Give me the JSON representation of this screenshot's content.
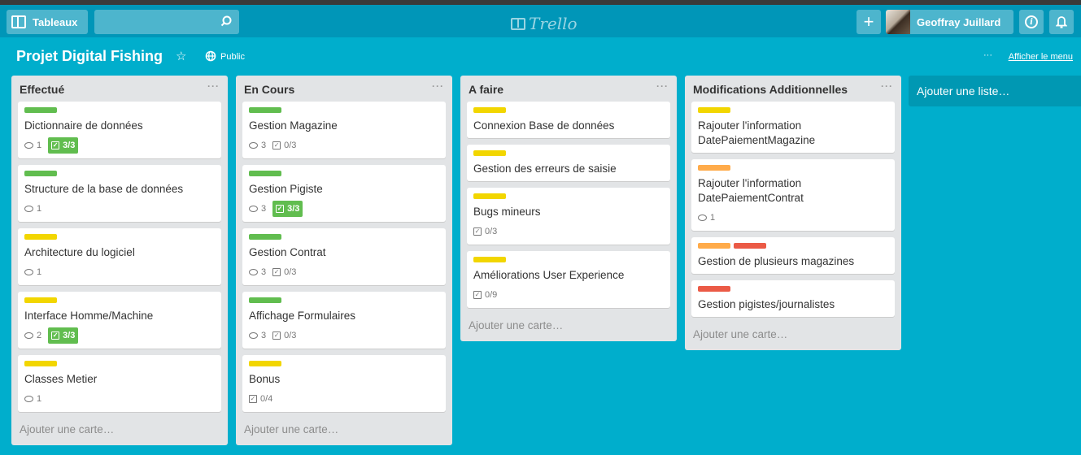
{
  "header": {
    "boards_label": "Tableaux",
    "logo_text": "Trello",
    "user_name": "Geoffray Juillard"
  },
  "board": {
    "title": "Projet Digital Fishing",
    "visibility": "Public",
    "menu_dots": "···",
    "show_menu_label": "Afficher le menu"
  },
  "colors": {
    "background": "#00aecc",
    "header": "#0096b8",
    "label_green": "#61bd4f",
    "label_yellow": "#f2d600",
    "label_orange": "#ffab4a",
    "label_red": "#eb5a46"
  },
  "lists": [
    {
      "name": "Effectué",
      "add_card": "Ajouter une carte…",
      "cards": [
        {
          "title": "Dictionnaire de données",
          "labels": [
            "green"
          ],
          "comments": "1",
          "checklist": "3/3",
          "complete": true
        },
        {
          "title": "Structure de la base de données",
          "labels": [
            "green"
          ],
          "comments": "1"
        },
        {
          "title": "Architecture du logiciel",
          "labels": [
            "yellow"
          ],
          "comments": "1"
        },
        {
          "title": "Interface Homme/Machine",
          "labels": [
            "yellow"
          ],
          "comments": "2",
          "checklist": "3/3",
          "complete": true
        },
        {
          "title": "Classes Metier",
          "labels": [
            "yellow"
          ],
          "comments": "1"
        }
      ]
    },
    {
      "name": "En Cours",
      "add_card": "Ajouter une carte…",
      "cards": [
        {
          "title": "Gestion Magazine",
          "labels": [
            "green"
          ],
          "comments": "3",
          "checklist": "0/3"
        },
        {
          "title": "Gestion Pigiste",
          "labels": [
            "green"
          ],
          "comments": "3",
          "checklist": "3/3",
          "complete": true
        },
        {
          "title": "Gestion Contrat",
          "labels": [
            "green"
          ],
          "comments": "3",
          "checklist": "0/3"
        },
        {
          "title": "Affichage Formulaires",
          "labels": [
            "green"
          ],
          "comments": "3",
          "checklist": "0/3"
        },
        {
          "title": "Bonus",
          "labels": [
            "yellow"
          ],
          "checklist": "0/4"
        }
      ]
    },
    {
      "name": "A faire",
      "add_card": "Ajouter une carte…",
      "cards": [
        {
          "title": "Connexion Base de données",
          "labels": [
            "yellow"
          ]
        },
        {
          "title": "Gestion des erreurs de saisie",
          "labels": [
            "yellow"
          ]
        },
        {
          "title": "Bugs mineurs",
          "labels": [
            "yellow"
          ],
          "checklist": "0/3"
        },
        {
          "title": "Améliorations User Experience",
          "labels": [
            "yellow"
          ],
          "checklist": "0/9"
        }
      ]
    },
    {
      "name": "Modifications Additionnelles",
      "add_card": "Ajouter une carte…",
      "cards": [
        {
          "title": "Rajouter l'information DatePaiementMagazine",
          "labels": [
            "yellow"
          ]
        },
        {
          "title": "Rajouter l'information DatePaiementContrat",
          "labels": [
            "orange"
          ],
          "comments": "1"
        },
        {
          "title": "Gestion de plusieurs magazines",
          "labels": [
            "orange",
            "red"
          ]
        },
        {
          "title": "Gestion pigistes/journalistes",
          "labels": [
            "red"
          ]
        }
      ]
    }
  ],
  "add_list_label": "Ajouter une liste…"
}
